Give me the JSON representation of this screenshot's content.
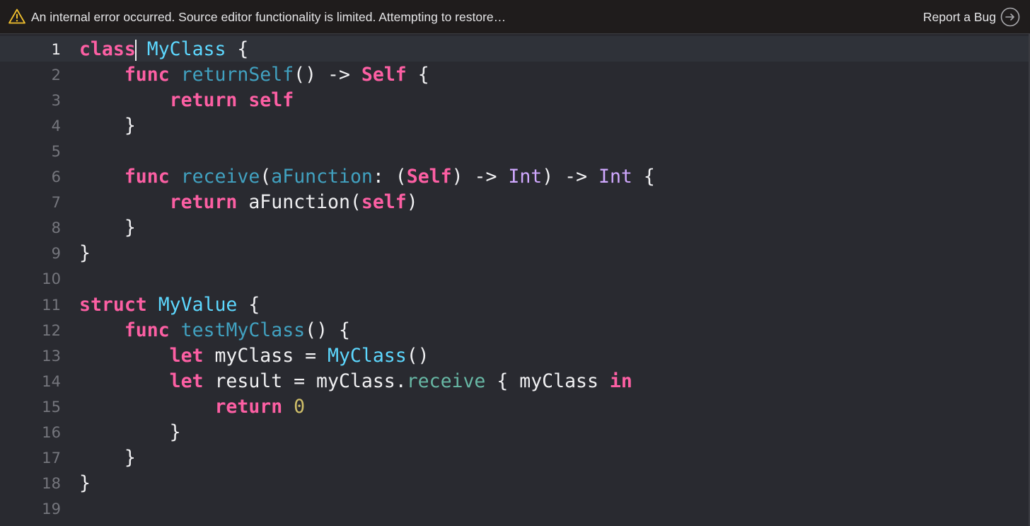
{
  "banner": {
    "message": "An internal error occurred. Source editor functionality is limited. Attempting to restore…",
    "report_label": "Report a Bug",
    "warning_icon": "warning-triangle-icon",
    "report_icon": "arrow-right-circle-icon"
  },
  "colors": {
    "background": "#292a30",
    "banner_background": "#1f1c1c",
    "keyword": "#fc5fa3",
    "declaration": "#5dd8ff",
    "function": "#41a1c0",
    "type": "#d0a8ff",
    "method": "#67b7a4",
    "number": "#d0bf69",
    "plain": "#f0f0f2",
    "line_number": "#75767d"
  },
  "editor": {
    "current_line": 1,
    "lines": [
      {
        "num": "1",
        "tokens": [
          [
            "kw",
            "class"
          ],
          [
            "caret",
            ""
          ],
          [
            "pl",
            " "
          ],
          [
            "decl",
            "MyClass"
          ],
          [
            "pl",
            " {"
          ]
        ]
      },
      {
        "num": "2",
        "tokens": [
          [
            "pl",
            "    "
          ],
          [
            "kw",
            "func"
          ],
          [
            "pl",
            " "
          ],
          [
            "fn",
            "returnSelf"
          ],
          [
            "pl",
            "() -> "
          ],
          [
            "kw",
            "Self"
          ],
          [
            "pl",
            " {"
          ]
        ]
      },
      {
        "num": "3",
        "tokens": [
          [
            "pl",
            "        "
          ],
          [
            "kw",
            "return"
          ],
          [
            "pl",
            " "
          ],
          [
            "kw",
            "self"
          ]
        ]
      },
      {
        "num": "4",
        "tokens": [
          [
            "pl",
            "    }"
          ]
        ]
      },
      {
        "num": "5",
        "tokens": []
      },
      {
        "num": "6",
        "tokens": [
          [
            "pl",
            "    "
          ],
          [
            "kw",
            "func"
          ],
          [
            "pl",
            " "
          ],
          [
            "fn",
            "receive"
          ],
          [
            "pl",
            "("
          ],
          [
            "fn",
            "aFunction"
          ],
          [
            "pl",
            ": ("
          ],
          [
            "kw",
            "Self"
          ],
          [
            "pl",
            ") -> "
          ],
          [
            "ty",
            "Int"
          ],
          [
            "pl",
            ") -> "
          ],
          [
            "ty",
            "Int"
          ],
          [
            "pl",
            " {"
          ]
        ]
      },
      {
        "num": "7",
        "tokens": [
          [
            "pl",
            "        "
          ],
          [
            "kw",
            "return"
          ],
          [
            "pl",
            " aFunction("
          ],
          [
            "kw",
            "self"
          ],
          [
            "pl",
            ")"
          ]
        ]
      },
      {
        "num": "8",
        "tokens": [
          [
            "pl",
            "    }"
          ]
        ]
      },
      {
        "num": "9",
        "tokens": [
          [
            "pl",
            "}"
          ]
        ]
      },
      {
        "num": "10",
        "tokens": []
      },
      {
        "num": "11",
        "tokens": [
          [
            "kw",
            "struct"
          ],
          [
            "pl",
            " "
          ],
          [
            "decl",
            "MyValue"
          ],
          [
            "pl",
            " {"
          ]
        ]
      },
      {
        "num": "12",
        "tokens": [
          [
            "pl",
            "    "
          ],
          [
            "kw",
            "func"
          ],
          [
            "pl",
            " "
          ],
          [
            "fn",
            "testMyClass"
          ],
          [
            "pl",
            "() {"
          ]
        ]
      },
      {
        "num": "13",
        "tokens": [
          [
            "pl",
            "        "
          ],
          [
            "kw",
            "let"
          ],
          [
            "pl",
            " myClass = "
          ],
          [
            "decl",
            "MyClass"
          ],
          [
            "pl",
            "()"
          ]
        ]
      },
      {
        "num": "14",
        "tokens": [
          [
            "pl",
            "        "
          ],
          [
            "kw",
            "let"
          ],
          [
            "pl",
            " result = myClass."
          ],
          [
            "mth",
            "receive"
          ],
          [
            "pl",
            " { myClass "
          ],
          [
            "kw",
            "in"
          ]
        ]
      },
      {
        "num": "15",
        "tokens": [
          [
            "pl",
            "            "
          ],
          [
            "kw",
            "return"
          ],
          [
            "pl",
            " "
          ],
          [
            "num",
            "0"
          ]
        ]
      },
      {
        "num": "16",
        "tokens": [
          [
            "pl",
            "        }"
          ]
        ]
      },
      {
        "num": "17",
        "tokens": [
          [
            "pl",
            "    }"
          ]
        ]
      },
      {
        "num": "18",
        "tokens": [
          [
            "pl",
            "}"
          ]
        ]
      },
      {
        "num": "19",
        "tokens": []
      }
    ]
  }
}
